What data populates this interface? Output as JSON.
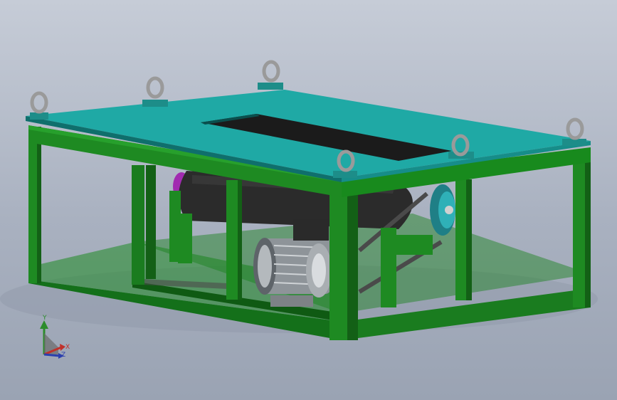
{
  "viewport": {
    "background_top": "#c6ccd7",
    "background_bottom": "#9aa3b3"
  },
  "model": {
    "frame_color": "#1e8a22",
    "frame_dark": "#136016",
    "top_plate_color": "#1fa9a5",
    "drum_color": "#2b2b2b",
    "motor_color": "#9aa0a6",
    "pulley_color": "#1f7f86",
    "accent_color": "#a12ab0",
    "lifting_eye_count": 6
  },
  "triad": {
    "x_label": "X",
    "y_label": "Y",
    "z_label": "Z",
    "x_color": "#c0302a",
    "y_color": "#2c8c2c",
    "z_color": "#2b3fae"
  }
}
